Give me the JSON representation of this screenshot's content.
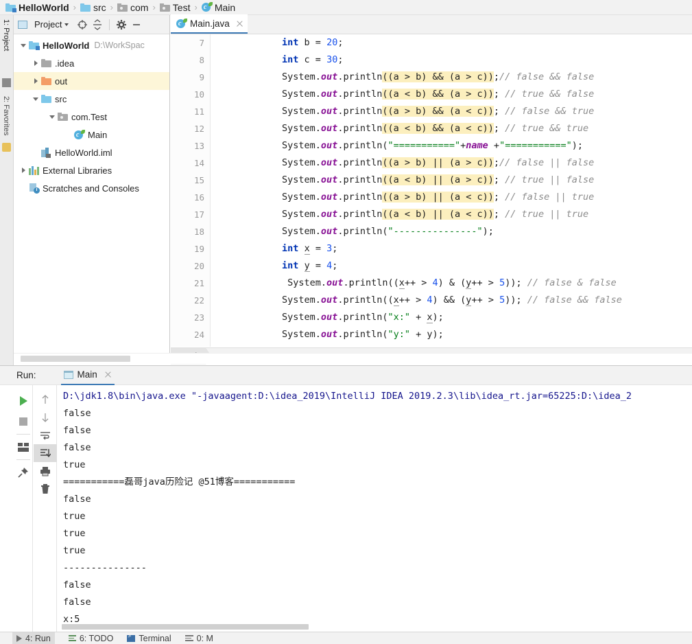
{
  "navbar": {
    "crumbs": [
      {
        "label": "HelloWorld",
        "icon": "module-icon",
        "bold": true
      },
      {
        "label": "src",
        "icon": "folder-blue-icon",
        "bold": false
      },
      {
        "label": "com",
        "icon": "package-icon",
        "bold": false
      },
      {
        "label": "Test",
        "icon": "package-icon",
        "bold": false
      },
      {
        "label": "Main",
        "icon": "java-class-icon",
        "bold": false
      }
    ],
    "separator": "›"
  },
  "left_strip": {
    "items": [
      {
        "label": "1: Project",
        "selected": true
      },
      {
        "label": "2: Favorites",
        "selected": false
      }
    ]
  },
  "project_panel": {
    "title": "Project",
    "toolbar_icons": [
      "project-view-dropdown-icon",
      "locate-target-icon",
      "collapse-all-icon",
      "settings-gear-icon",
      "hide-panel-icon"
    ],
    "tree": [
      {
        "label": "HelloWorld",
        "sublabel": "D:\\WorkSpac",
        "icon": "module-icon",
        "indent": 0,
        "twisty": "down",
        "bold": true,
        "highlight": false
      },
      {
        "label": ".idea",
        "sublabel": "",
        "icon": "folder-grey-icon",
        "indent": 1,
        "twisty": "right",
        "bold": false,
        "highlight": false
      },
      {
        "label": "out",
        "sublabel": "",
        "icon": "folder-orange-icon",
        "indent": 1,
        "twisty": "right",
        "bold": false,
        "highlight": true
      },
      {
        "label": "src",
        "sublabel": "",
        "icon": "folder-blue-icon",
        "indent": 1,
        "twisty": "down",
        "bold": false,
        "highlight": false
      },
      {
        "label": "com.Test",
        "sublabel": "",
        "icon": "package-icon",
        "indent": 2,
        "twisty": "down",
        "bold": false,
        "highlight": false
      },
      {
        "label": "Main",
        "sublabel": "",
        "icon": "java-class-icon",
        "indent": 3,
        "twisty": "none",
        "bold": false,
        "highlight": false
      },
      {
        "label": "HelloWorld.iml",
        "sublabel": "",
        "icon": "iml-file-icon",
        "indent": 1,
        "twisty": "none",
        "bold": false,
        "highlight": false
      },
      {
        "label": "External Libraries",
        "sublabel": "",
        "icon": "libraries-icon",
        "indent": 0,
        "twisty": "right",
        "bold": false,
        "highlight": false
      },
      {
        "label": "Scratches and Consoles",
        "sublabel": "",
        "icon": "scratches-icon",
        "indent": 0,
        "twisty": "none",
        "bold": false,
        "highlight": false
      }
    ]
  },
  "editor": {
    "tab": {
      "label": "Main.java",
      "icon": "java-class-icon",
      "close_icon": "close-icon"
    },
    "breadcrumb": "Main",
    "first_line_number": 7,
    "lines": [
      {
        "n": 7,
        "tokens": [
          {
            "t": "        ",
            "c": ""
          },
          {
            "t": "int",
            "c": "kw"
          },
          {
            "t": " b = ",
            "c": ""
          },
          {
            "t": "20",
            "c": "num"
          },
          {
            "t": ";",
            "c": ""
          }
        ]
      },
      {
        "n": 8,
        "tokens": [
          {
            "t": "        ",
            "c": ""
          },
          {
            "t": "int",
            "c": "kw"
          },
          {
            "t": " c = ",
            "c": ""
          },
          {
            "t": "30",
            "c": "num"
          },
          {
            "t": ";",
            "c": ""
          }
        ]
      },
      {
        "n": 9,
        "tokens": [
          {
            "t": "        System.",
            "c": ""
          },
          {
            "t": "out",
            "c": "fld"
          },
          {
            "t": ".println",
            "c": ""
          },
          {
            "t": "((a > b) && (a > c))",
            "c": "hl"
          },
          {
            "t": ";",
            "c": ""
          },
          {
            "t": "// false && false",
            "c": "cmt"
          }
        ]
      },
      {
        "n": 10,
        "tokens": [
          {
            "t": "        System.",
            "c": ""
          },
          {
            "t": "out",
            "c": "fld"
          },
          {
            "t": ".println",
            "c": ""
          },
          {
            "t": "((a < b) && (a > c))",
            "c": "hl"
          },
          {
            "t": "; ",
            "c": ""
          },
          {
            "t": "// true && false",
            "c": "cmt"
          }
        ]
      },
      {
        "n": 11,
        "tokens": [
          {
            "t": "        System.",
            "c": ""
          },
          {
            "t": "out",
            "c": "fld"
          },
          {
            "t": ".println",
            "c": ""
          },
          {
            "t": "((a > b) && (a < c))",
            "c": "hl"
          },
          {
            "t": "; ",
            "c": ""
          },
          {
            "t": "// false && true",
            "c": "cmt"
          }
        ]
      },
      {
        "n": 12,
        "tokens": [
          {
            "t": "        System.",
            "c": ""
          },
          {
            "t": "out",
            "c": "fld"
          },
          {
            "t": ".println",
            "c": ""
          },
          {
            "t": "((a < b) && (a < c))",
            "c": "hl"
          },
          {
            "t": "; ",
            "c": ""
          },
          {
            "t": "// true && true",
            "c": "cmt"
          }
        ]
      },
      {
        "n": 13,
        "tokens": [
          {
            "t": "        System.",
            "c": ""
          },
          {
            "t": "out",
            "c": "fld"
          },
          {
            "t": ".println(",
            "c": ""
          },
          {
            "t": "\"===========\"",
            "c": "str"
          },
          {
            "t": "+",
            "c": ""
          },
          {
            "t": "name",
            "c": "fld"
          },
          {
            "t": " +",
            "c": ""
          },
          {
            "t": "\"===========\"",
            "c": "str"
          },
          {
            "t": ");",
            "c": ""
          }
        ]
      },
      {
        "n": 14,
        "tokens": [
          {
            "t": "        System.",
            "c": ""
          },
          {
            "t": "out",
            "c": "fld"
          },
          {
            "t": ".println",
            "c": ""
          },
          {
            "t": "((a > b) || (a > c))",
            "c": "hl"
          },
          {
            "t": ";",
            "c": ""
          },
          {
            "t": "// false || false",
            "c": "cmt"
          }
        ]
      },
      {
        "n": 15,
        "tokens": [
          {
            "t": "        System.",
            "c": ""
          },
          {
            "t": "out",
            "c": "fld"
          },
          {
            "t": ".println",
            "c": ""
          },
          {
            "t": "((a < b) || (a > c))",
            "c": "hl"
          },
          {
            "t": "; ",
            "c": ""
          },
          {
            "t": "// true || false",
            "c": "cmt"
          }
        ]
      },
      {
        "n": 16,
        "tokens": [
          {
            "t": "        System.",
            "c": ""
          },
          {
            "t": "out",
            "c": "fld"
          },
          {
            "t": ".println",
            "c": ""
          },
          {
            "t": "((a > b) || (a < c))",
            "c": "hl"
          },
          {
            "t": "; ",
            "c": ""
          },
          {
            "t": "// false || true",
            "c": "cmt"
          }
        ]
      },
      {
        "n": 17,
        "tokens": [
          {
            "t": "        System.",
            "c": ""
          },
          {
            "t": "out",
            "c": "fld"
          },
          {
            "t": ".println",
            "c": ""
          },
          {
            "t": "((a < b) || (a < c))",
            "c": "hl"
          },
          {
            "t": "; ",
            "c": ""
          },
          {
            "t": "// true || true",
            "c": "cmt"
          }
        ]
      },
      {
        "n": 18,
        "tokens": [
          {
            "t": "        System.",
            "c": ""
          },
          {
            "t": "out",
            "c": "fld"
          },
          {
            "t": ".println(",
            "c": ""
          },
          {
            "t": "\"---------------\"",
            "c": "str"
          },
          {
            "t": ");",
            "c": ""
          }
        ]
      },
      {
        "n": 19,
        "tokens": [
          {
            "t": "        ",
            "c": ""
          },
          {
            "t": "int",
            "c": "kw"
          },
          {
            "t": " ",
            "c": ""
          },
          {
            "t": "x",
            "c": "var-u"
          },
          {
            "t": " = ",
            "c": ""
          },
          {
            "t": "3",
            "c": "num"
          },
          {
            "t": ";",
            "c": ""
          }
        ]
      },
      {
        "n": 20,
        "tokens": [
          {
            "t": "        ",
            "c": ""
          },
          {
            "t": "int",
            "c": "kw"
          },
          {
            "t": " ",
            "c": ""
          },
          {
            "t": "y",
            "c": "var-u"
          },
          {
            "t": " = ",
            "c": ""
          },
          {
            "t": "4",
            "c": "num"
          },
          {
            "t": ";",
            "c": ""
          }
        ]
      },
      {
        "n": 21,
        "tokens": [
          {
            "t": "         System.",
            "c": ""
          },
          {
            "t": "out",
            "c": "fld"
          },
          {
            "t": ".println((",
            "c": ""
          },
          {
            "t": "x",
            "c": "var-u"
          },
          {
            "t": "++ > ",
            "c": ""
          },
          {
            "t": "4",
            "c": "num"
          },
          {
            "t": ") & (",
            "c": ""
          },
          {
            "t": "y",
            "c": "var-u"
          },
          {
            "t": "++ > ",
            "c": ""
          },
          {
            "t": "5",
            "c": "num"
          },
          {
            "t": ")); ",
            "c": ""
          },
          {
            "t": "// false & false",
            "c": "cmt"
          }
        ]
      },
      {
        "n": 22,
        "tokens": [
          {
            "t": "        System.",
            "c": ""
          },
          {
            "t": "out",
            "c": "fld"
          },
          {
            "t": ".println((",
            "c": ""
          },
          {
            "t": "x",
            "c": "var-u"
          },
          {
            "t": "++ > ",
            "c": ""
          },
          {
            "t": "4",
            "c": "num"
          },
          {
            "t": ") && (",
            "c": ""
          },
          {
            "t": "y",
            "c": "var-u"
          },
          {
            "t": "++ > ",
            "c": ""
          },
          {
            "t": "5",
            "c": "num"
          },
          {
            "t": ")); ",
            "c": ""
          },
          {
            "t": "// false && false",
            "c": "cmt"
          }
        ]
      },
      {
        "n": 23,
        "tokens": [
          {
            "t": "        System.",
            "c": ""
          },
          {
            "t": "out",
            "c": "fld"
          },
          {
            "t": ".println(",
            "c": ""
          },
          {
            "t": "\"x:\"",
            "c": "str"
          },
          {
            "t": " + ",
            "c": ""
          },
          {
            "t": "x",
            "c": "var-u"
          },
          {
            "t": ");",
            "c": ""
          }
        ]
      },
      {
        "n": 24,
        "tokens": [
          {
            "t": "        System.",
            "c": ""
          },
          {
            "t": "out",
            "c": "fld"
          },
          {
            "t": ".println(",
            "c": ""
          },
          {
            "t": "\"y:\"",
            "c": "str"
          },
          {
            "t": " + y);",
            "c": ""
          }
        ]
      }
    ]
  },
  "run_panel": {
    "label": "Run:",
    "tab": {
      "label": "Main",
      "icon": "console-icon",
      "close_icon": "close-icon"
    },
    "left_buttons": [
      "rerun-play-icon",
      "stop-icon",
      "restore-layout-icon",
      "pin-tab-icon"
    ],
    "right_buttons": [
      "up-arrow-icon",
      "down-arrow-icon",
      "soft-wrap-icon",
      "scroll-to-end-icon",
      "print-icon",
      "trash-icon"
    ],
    "console_lines": [
      {
        "text": "D:\\jdk1.8\\bin\\java.exe \"-javaagent:D:\\idea_2019\\IntelliJ IDEA 2019.2.3\\lib\\idea_rt.jar=65225:D:\\idea_2",
        "kind": "command"
      },
      {
        "text": "false",
        "kind": "out"
      },
      {
        "text": "false",
        "kind": "out"
      },
      {
        "text": "false",
        "kind": "out"
      },
      {
        "text": "true",
        "kind": "out"
      },
      {
        "text": "===========磊哥java历险记 @51博客===========",
        "kind": "out"
      },
      {
        "text": "false",
        "kind": "out"
      },
      {
        "text": "true",
        "kind": "out"
      },
      {
        "text": "true",
        "kind": "out"
      },
      {
        "text": "true",
        "kind": "out"
      },
      {
        "text": "---------------",
        "kind": "out"
      },
      {
        "text": "false",
        "kind": "out"
      },
      {
        "text": "false",
        "kind": "out"
      },
      {
        "text": "x:5",
        "kind": "out"
      }
    ]
  },
  "status_bar": {
    "items": [
      {
        "label": "4: Run",
        "icon": "run-icon",
        "active": true
      },
      {
        "label": "6: TODO",
        "icon": "todo-icon",
        "active": false
      },
      {
        "label": "Terminal",
        "icon": "terminal-icon",
        "active": false
      },
      {
        "label": "0: M",
        "icon": "messages-icon",
        "active": false
      }
    ]
  },
  "colors": {
    "accent": "#3d7ab5",
    "highlight": "#fcefbe",
    "tree_highlight": "#fdf6d8",
    "keyword": "#0033b3",
    "string": "#047d18",
    "number": "#1750eb",
    "field": "#871094",
    "comment": "#8c8c8c",
    "command": "#14148c",
    "panel_bg": "#f2f2f2"
  }
}
